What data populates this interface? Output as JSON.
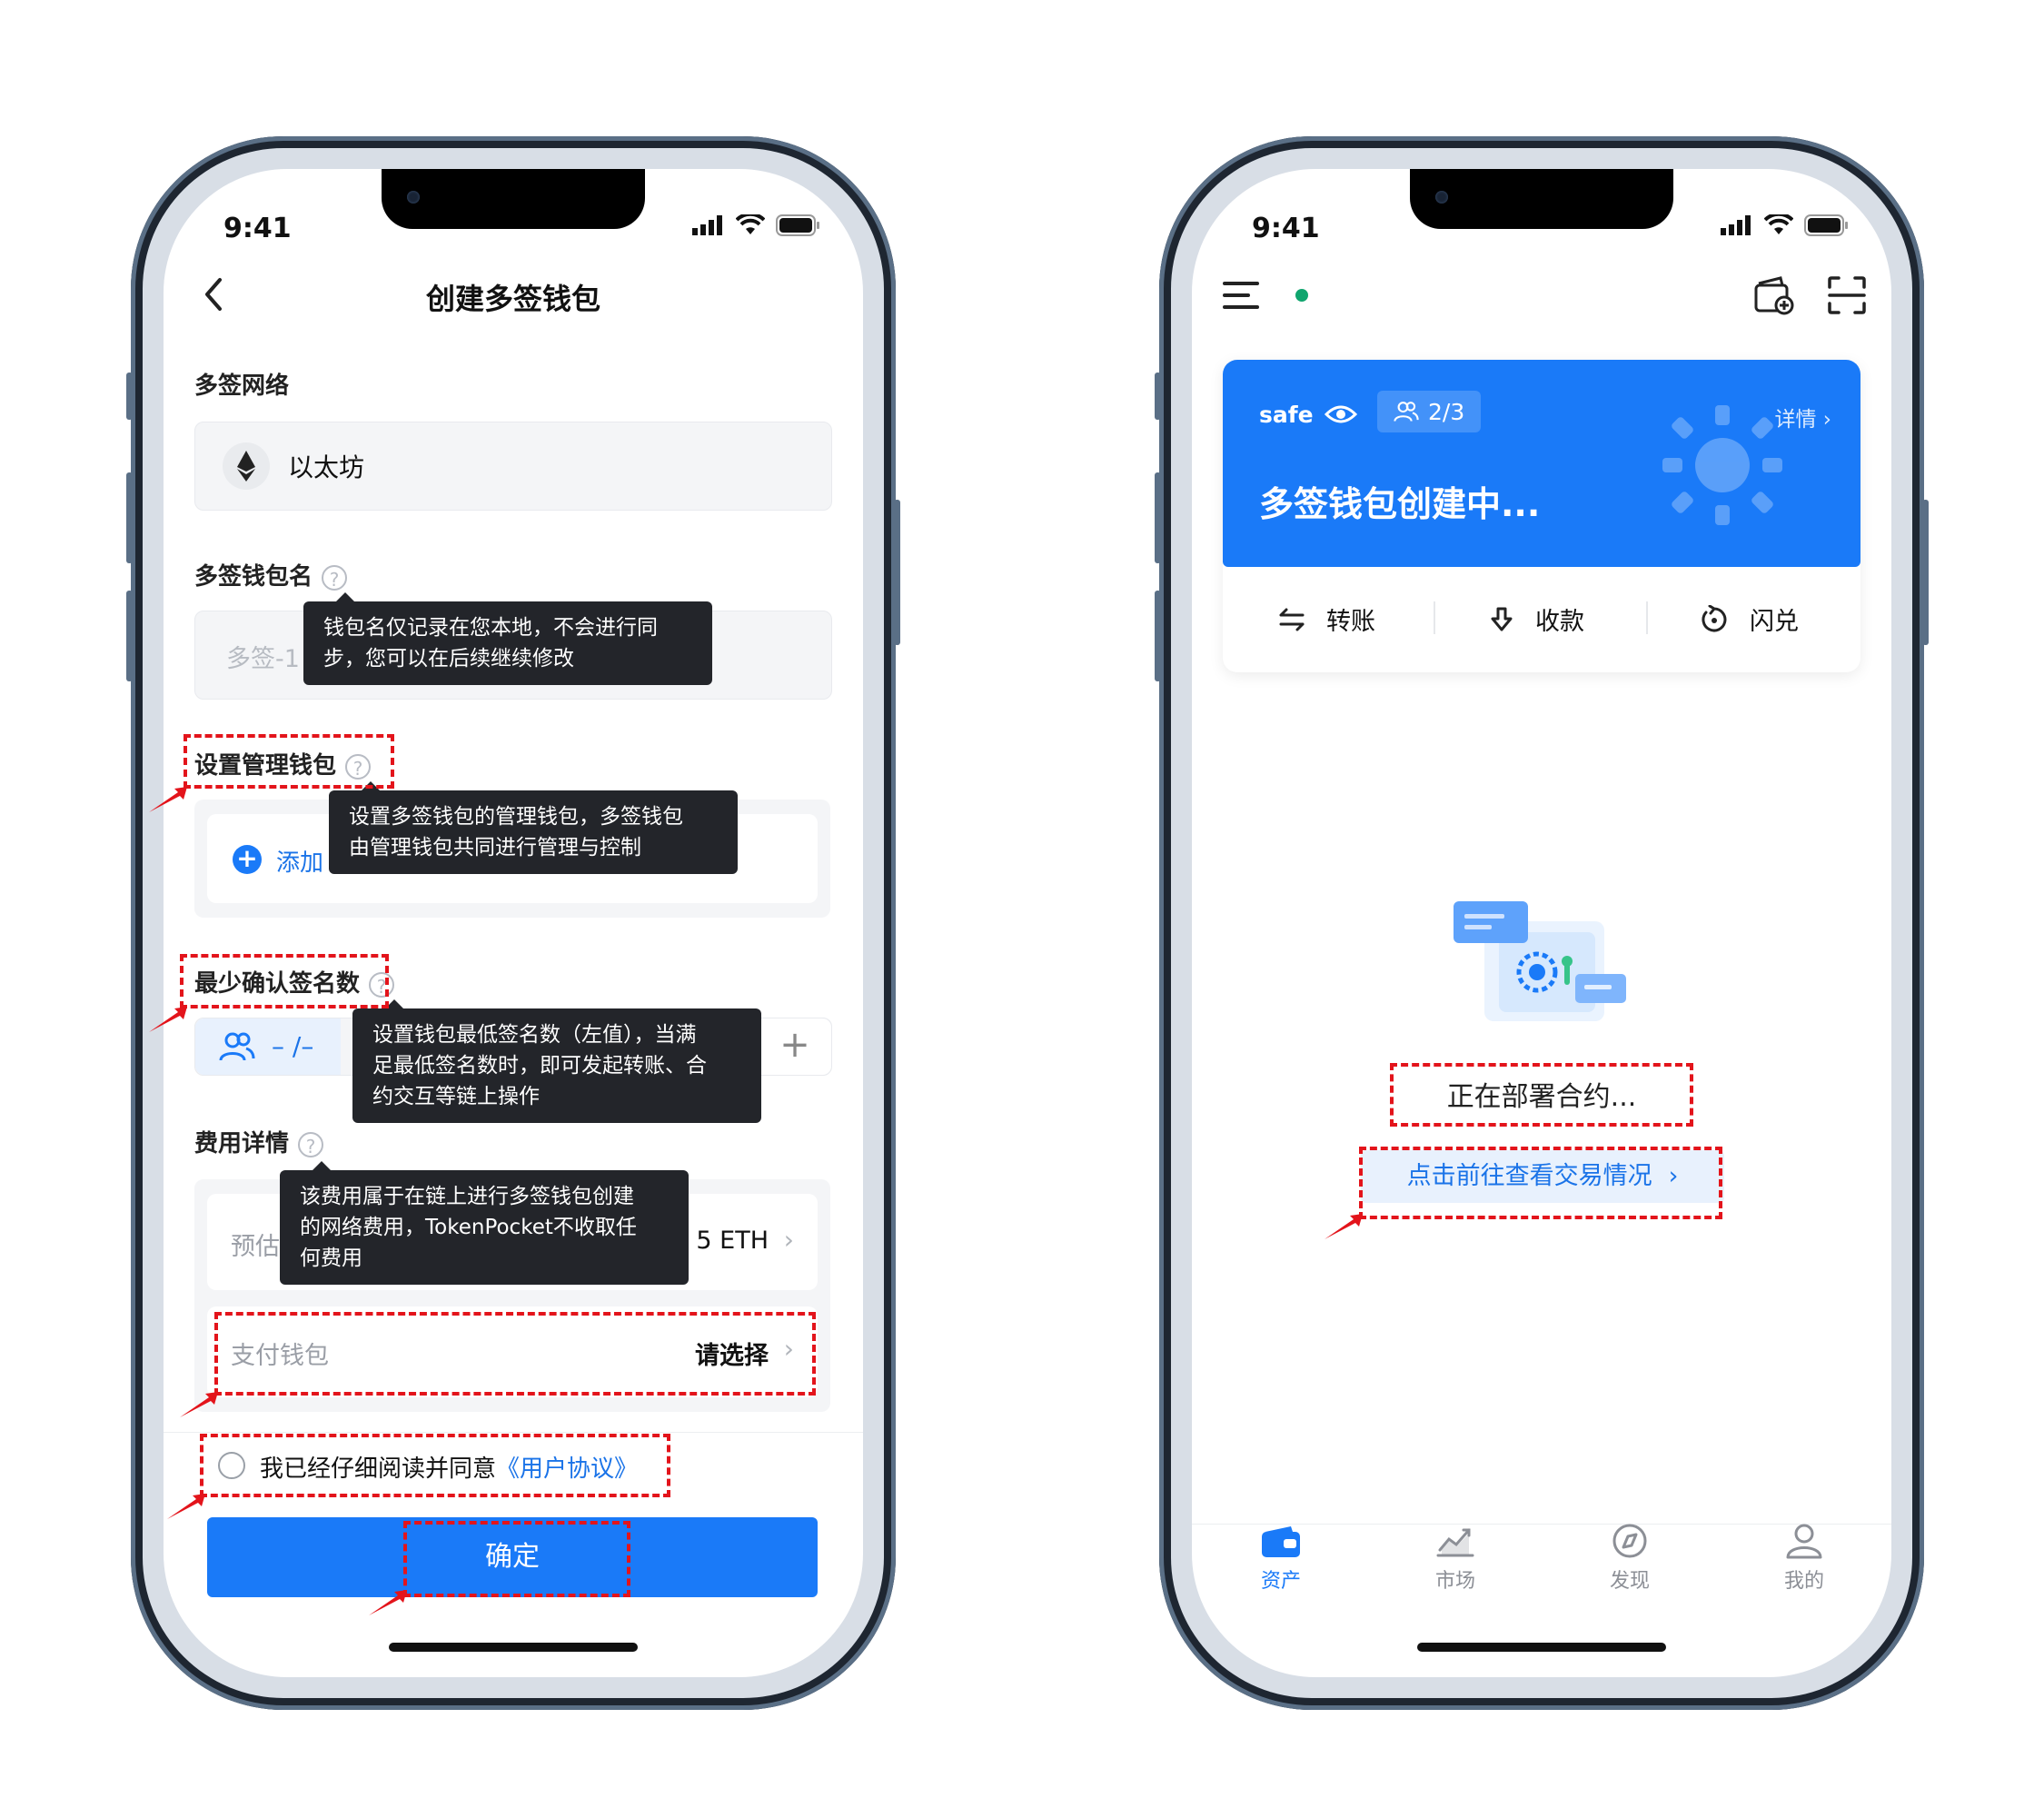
{
  "status_time": "9:41",
  "left": {
    "title": "创建多签钱包",
    "network": {
      "label": "多签网络",
      "value": "以太坊"
    },
    "wallet_name": {
      "label": "多签钱包名",
      "placeholder": "多签-1",
      "tooltip": [
        "钱包名仅记录在您本地，不会进行同",
        "步，您可以在后续继续修改"
      ]
    },
    "admin": {
      "label": "设置管理钱包",
      "add_label": "添加",
      "tooltip": [
        "设置多签钱包的管理钱包，多签钱包",
        "由管理钱包共同进行管理与控制"
      ]
    },
    "min_sign": {
      "label": "最少确认签名数",
      "value": "– /–",
      "plus": "+",
      "tooltip": [
        "设置钱包最低签名数（左值），当满",
        "足最低签名数时，即可发起转账、合",
        "约交互等链上操作"
      ]
    },
    "fee": {
      "label": "费用详情",
      "estimate_label": "预估",
      "estimate_value": "5 ETH",
      "tooltip": [
        "该费用属于在链上进行多签钱包创建",
        "的网络费用，TokenPocket不收取任",
        "何费用"
      ]
    },
    "pay_wallet": {
      "label": "支付钱包",
      "value": "请选择"
    },
    "agreement": {
      "text": "我已经仔细阅读并同意",
      "link": "《用户协议》"
    },
    "confirm": "确定"
  },
  "right": {
    "card": {
      "name": "safe",
      "sig": "2/3",
      "detail": "详情",
      "status": "多签钱包创建中..."
    },
    "actions": [
      "转账",
      "收款",
      "闪兑"
    ],
    "deploying": "正在部署合约...",
    "view_tx": "点击前往查看交易情况",
    "tabs": [
      "资产",
      "市场",
      "发现",
      "我的"
    ],
    "accent": "#1a7af8"
  }
}
